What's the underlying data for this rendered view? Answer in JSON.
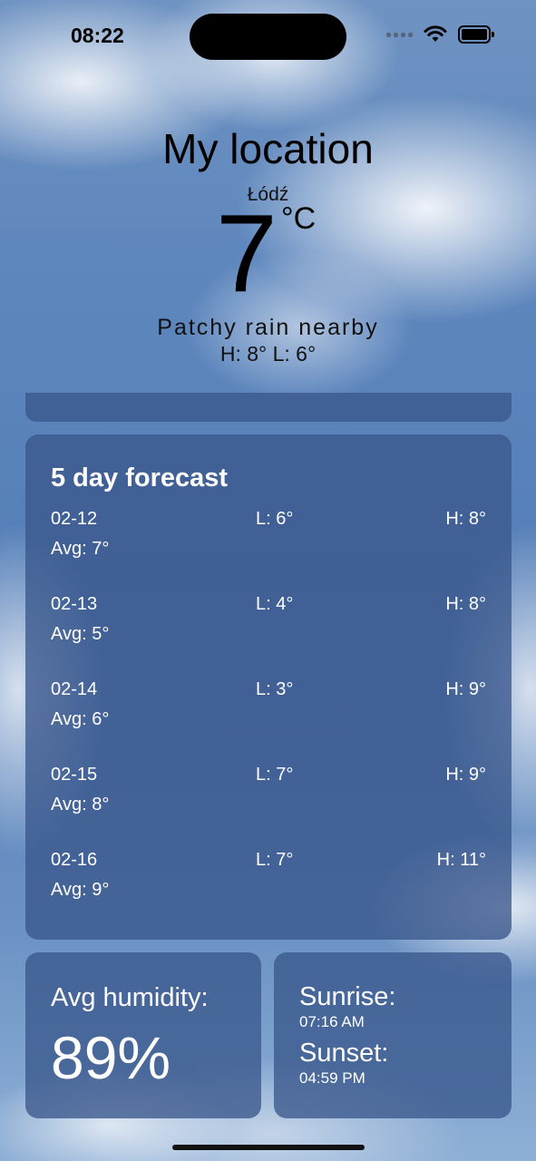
{
  "status_bar": {
    "time": "08:22"
  },
  "header": {
    "title": "My location",
    "city": "Łódź",
    "temperature": "7",
    "unit": "°C",
    "condition": "Patchy rain nearby",
    "hilo": "H: 8° L: 6°"
  },
  "forecast": {
    "title": "5 day forecast",
    "days": [
      {
        "date": "02-12",
        "low": "L: 6°",
        "high": "H: 8°",
        "avg": "Avg: 7°"
      },
      {
        "date": "02-13",
        "low": "L: 4°",
        "high": "H: 8°",
        "avg": "Avg: 5°"
      },
      {
        "date": "02-14",
        "low": "L: 3°",
        "high": "H: 9°",
        "avg": "Avg: 6°"
      },
      {
        "date": "02-15",
        "low": "L: 7°",
        "high": "H: 9°",
        "avg": "Avg: 8°"
      },
      {
        "date": "02-16",
        "low": "L: 7°",
        "high": "H: 11°",
        "avg": "Avg: 9°"
      }
    ]
  },
  "humidity": {
    "label": "Avg humidity:",
    "value": "89%"
  },
  "sun": {
    "sunrise_label": "Sunrise:",
    "sunrise_time": "07:16 AM",
    "sunset_label": "Sunset:",
    "sunset_time": "04:59 PM"
  },
  "colors": {
    "card_background": "#3a578c",
    "sky": "#5d86bd"
  }
}
